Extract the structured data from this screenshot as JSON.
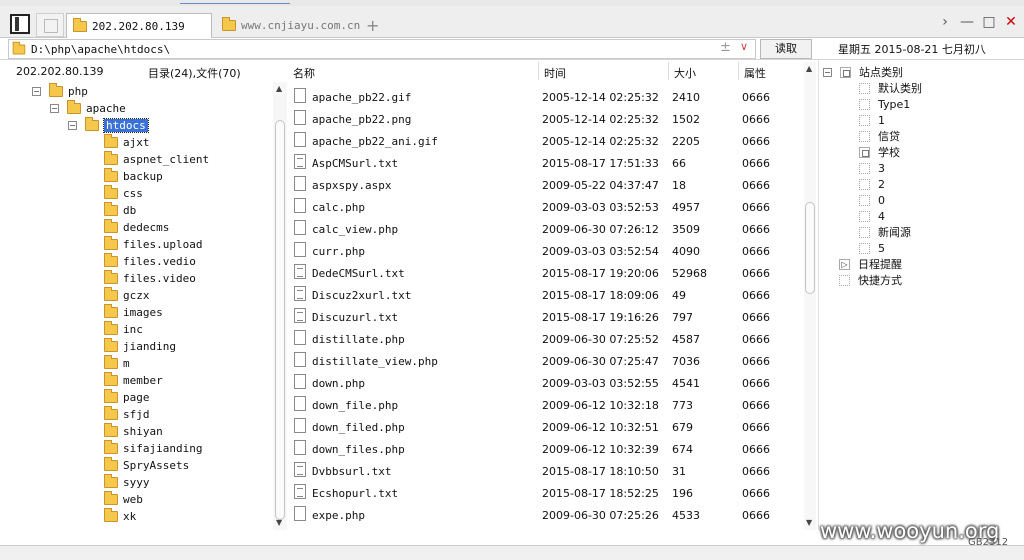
{
  "tabs": [
    {
      "label": "202.202.80.139"
    },
    {
      "label": "www.cnjiayu.com.cn"
    }
  ],
  "new_tab_icon": "plus-icon",
  "window_controls": {
    "minimize": "—",
    "maximize": "□",
    "close": "✕"
  },
  "address": {
    "path": "D:\\php\\apache\\htdocs\\",
    "plus": "±",
    "dropdown": "∨",
    "read_label": "读取"
  },
  "date_label": "星期五 2015-08-21 七月初八",
  "header": {
    "host": "202.202.80.139",
    "counts": "目录(24),文件(70)",
    "col_name": "名称",
    "col_time": "时间",
    "col_size": "大小",
    "col_attr": "属性"
  },
  "tree": [
    {
      "label": "php",
      "level": 0,
      "toggle": "−",
      "open": true
    },
    {
      "label": "apache",
      "level": 1,
      "toggle": "−",
      "open": true
    },
    {
      "label": "htdocs",
      "level": 2,
      "toggle": "−",
      "open": true,
      "selected": true
    },
    {
      "label": "ajxt",
      "level": 3
    },
    {
      "label": "aspnet_client",
      "level": 3
    },
    {
      "label": "backup",
      "level": 3
    },
    {
      "label": "css",
      "level": 3
    },
    {
      "label": "db",
      "level": 3
    },
    {
      "label": "dedecms",
      "level": 3
    },
    {
      "label": "files.upload",
      "level": 3
    },
    {
      "label": "files.vedio",
      "level": 3
    },
    {
      "label": "files.video",
      "level": 3
    },
    {
      "label": "gczx",
      "level": 3
    },
    {
      "label": "images",
      "level": 3
    },
    {
      "label": "inc",
      "level": 3
    },
    {
      "label": "jianding",
      "level": 3
    },
    {
      "label": "m",
      "level": 3
    },
    {
      "label": "member",
      "level": 3
    },
    {
      "label": "page",
      "level": 3
    },
    {
      "label": "sfjd",
      "level": 3
    },
    {
      "label": "shiyan",
      "level": 3
    },
    {
      "label": "sifajianding",
      "level": 3
    },
    {
      "label": "SpryAssets",
      "level": 3
    },
    {
      "label": "syyy",
      "level": 3
    },
    {
      "label": "web",
      "level": 3
    },
    {
      "label": "xk",
      "level": 3
    }
  ],
  "files": [
    {
      "name": "apache_pb22.gif",
      "time": "2005-12-14 02:25:32",
      "size": "2410",
      "attr": "0666",
      "icon": "file"
    },
    {
      "name": "apache_pb22.png",
      "time": "2005-12-14 02:25:32",
      "size": "1502",
      "attr": "0666",
      "icon": "file"
    },
    {
      "name": "apache_pb22_ani.gif",
      "time": "2005-12-14 02:25:32",
      "size": "2205",
      "attr": "0666",
      "icon": "file"
    },
    {
      "name": "AspCMSurl.txt",
      "time": "2015-08-17 17:51:33",
      "size": "66",
      "attr": "0666",
      "icon": "txt"
    },
    {
      "name": "aspxspy.aspx",
      "time": "2009-05-22 04:37:47",
      "size": "18",
      "attr": "0666",
      "icon": "file"
    },
    {
      "name": "calc.php",
      "time": "2009-03-03 03:52:53",
      "size": "4957",
      "attr": "0666",
      "icon": "file"
    },
    {
      "name": "calc_view.php",
      "time": "2009-06-30 07:26:12",
      "size": "3509",
      "attr": "0666",
      "icon": "file"
    },
    {
      "name": "curr.php",
      "time": "2009-03-03 03:52:54",
      "size": "4090",
      "attr": "0666",
      "icon": "file"
    },
    {
      "name": "DedeCMSurl.txt",
      "time": "2015-08-17 19:20:06",
      "size": "52968",
      "attr": "0666",
      "icon": "txt"
    },
    {
      "name": "Discuz2xurl.txt",
      "time": "2015-08-17 18:09:06",
      "size": "49",
      "attr": "0666",
      "icon": "txt"
    },
    {
      "name": "Discuzurl.txt",
      "time": "2015-08-17 19:16:26",
      "size": "797",
      "attr": "0666",
      "icon": "txt"
    },
    {
      "name": "distillate.php",
      "time": "2009-06-30 07:25:52",
      "size": "4587",
      "attr": "0666",
      "icon": "file"
    },
    {
      "name": "distillate_view.php",
      "time": "2009-06-30 07:25:47",
      "size": "7036",
      "attr": "0666",
      "icon": "file"
    },
    {
      "name": "down.php",
      "time": "2009-03-03 03:52:55",
      "size": "4541",
      "attr": "0666",
      "icon": "file"
    },
    {
      "name": "down_file.php",
      "time": "2009-06-12 10:32:18",
      "size": "773",
      "attr": "0666",
      "icon": "file"
    },
    {
      "name": "down_filed.php",
      "time": "2009-06-12 10:32:51",
      "size": "679",
      "attr": "0666",
      "icon": "file"
    },
    {
      "name": "down_files.php",
      "time": "2009-06-12 10:32:39",
      "size": "674",
      "attr": "0666",
      "icon": "file"
    },
    {
      "name": "Dvbbsurl.txt",
      "time": "2015-08-17 18:10:50",
      "size": "31",
      "attr": "0666",
      "icon": "txt"
    },
    {
      "name": "Ecshopurl.txt",
      "time": "2015-08-17 18:52:25",
      "size": "196",
      "attr": "0666",
      "icon": "txt"
    },
    {
      "name": "expe.php",
      "time": "2009-06-30 07:25:26",
      "size": "4533",
      "attr": "0666",
      "icon": "file"
    }
  ],
  "categories": [
    {
      "label": "站点类别",
      "level": 0,
      "toggle": "−",
      "box": "plain"
    },
    {
      "label": "默认类别",
      "level": 1,
      "box": "dash"
    },
    {
      "label": "Type1",
      "level": 1,
      "box": "dash"
    },
    {
      "label": "1",
      "level": 1,
      "box": "dash"
    },
    {
      "label": "信贷",
      "level": 1,
      "box": "dash"
    },
    {
      "label": "学校",
      "level": 1,
      "box": "plain"
    },
    {
      "label": "3",
      "level": 1,
      "box": "dash"
    },
    {
      "label": "2",
      "level": 1,
      "box": "dash"
    },
    {
      "label": "0",
      "level": 1,
      "box": "dash"
    },
    {
      "label": "4",
      "level": 1,
      "box": "dash"
    },
    {
      "label": "新闻源",
      "level": 1,
      "box": "dash"
    },
    {
      "label": "5",
      "level": 1,
      "box": "dash"
    },
    {
      "label": "日程提醒",
      "level": 0,
      "box": "sched"
    },
    {
      "label": "快捷方式",
      "level": 0,
      "box": "page"
    }
  ],
  "watermark": "www.wooyun.org",
  "encoding": "GB2312"
}
